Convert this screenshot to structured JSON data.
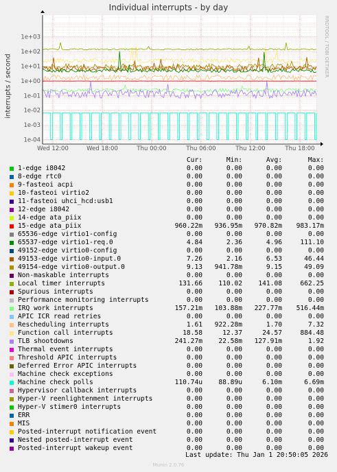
{
  "title": "Individual interrupts - by day",
  "ylabel": "interrupts / second",
  "sidebar_text": "RRDTOOL / TOBI OETIKER",
  "footer_update": "Last update: Thu Jan  1 20:50:05 2026",
  "footer_version": "Munin 2.0.76",
  "columns": {
    "cur": "Cur:",
    "min": "Min:",
    "avg": "Avg:",
    "max": "Max:"
  },
  "chart_data": {
    "type": "line",
    "title": "Individual interrupts - by day",
    "ylabel": "interrupts / second",
    "yscale": "log",
    "ylim": [
      5e-05,
      30000
    ],
    "y_ticks": [
      "1e+03",
      "1e+02",
      "1e+01",
      "1e+00",
      "1e-01",
      "1e-02",
      "1e-03",
      "1e-04"
    ],
    "x_ticks": [
      "Wed 12:00",
      "Wed 18:00",
      "Thu 00:00",
      "Thu 06:00",
      "Thu 12:00",
      "Thu 18:00"
    ],
    "grid": true,
    "series": [
      {
        "name": "1-edge i8042",
        "color": "#00cc00",
        "cur": "0.00",
        "min": "0.00",
        "avg": "0.00",
        "max": "0.00"
      },
      {
        "name": "8-edge rtc0",
        "color": "#0066b3",
        "cur": "0.00",
        "min": "0.00",
        "avg": "0.00",
        "max": "0.00"
      },
      {
        "name": "9-fasteoi acpi",
        "color": "#ff8000",
        "cur": "0.00",
        "min": "0.00",
        "avg": "0.00",
        "max": "0.00"
      },
      {
        "name": "10-fasteoi virtio2",
        "color": "#ffcc00",
        "cur": "0.00",
        "min": "0.00",
        "avg": "0.00",
        "max": "0.00"
      },
      {
        "name": "11-fasteoi uhci_hcd:usb1",
        "color": "#330099",
        "cur": "0.00",
        "min": "0.00",
        "avg": "0.00",
        "max": "0.00"
      },
      {
        "name": "12-edge i8042",
        "color": "#990099",
        "cur": "0.00",
        "min": "0.00",
        "avg": "0.00",
        "max": "0.00"
      },
      {
        "name": "14-edge ata_piix",
        "color": "#ccff00",
        "cur": "0.00",
        "min": "0.00",
        "avg": "0.00",
        "max": "0.00"
      },
      {
        "name": "15-edge ata_piix",
        "color": "#ff0000",
        "cur": "960.22m",
        "min": "936.95m",
        "avg": "970.82m",
        "max": "983.17m"
      },
      {
        "name": "65536-edge virtio1-config",
        "color": "#808080",
        "cur": "0.00",
        "min": "0.00",
        "avg": "0.00",
        "max": "0.00"
      },
      {
        "name": "65537-edge virtio1-req.0",
        "color": "#008f00",
        "cur": "4.84",
        "min": "2.36",
        "avg": "4.96",
        "max": "111.10"
      },
      {
        "name": "49152-edge virtio0-config",
        "color": "#00487d",
        "cur": "0.00",
        "min": "0.00",
        "avg": "0.00",
        "max": "0.00"
      },
      {
        "name": "49153-edge virtio0-input.0",
        "color": "#b35a00",
        "cur": "7.26",
        "min": "2.16",
        "avg": "6.53",
        "max": "46.44"
      },
      {
        "name": "49154-edge virtio0-output.0",
        "color": "#b38f00",
        "cur": "9.13",
        "min": "941.78m",
        "avg": "9.15",
        "max": "49.09"
      },
      {
        "name": "Non-maskable interrupts",
        "color": "#6b006b",
        "cur": "0.00",
        "min": "0.00",
        "avg": "0.00",
        "max": "0.00"
      },
      {
        "name": "Local timer interrupts",
        "color": "#8fb300",
        "cur": "131.66",
        "min": "110.02",
        "avg": "141.08",
        "max": "662.25"
      },
      {
        "name": "Spurious interrupts",
        "color": "#b30000",
        "cur": "0.00",
        "min": "0.00",
        "avg": "0.00",
        "max": "0.00"
      },
      {
        "name": "Performance monitoring interrupts",
        "color": "#bebebe",
        "cur": "0.00",
        "min": "0.00",
        "avg": "0.00",
        "max": "0.00"
      },
      {
        "name": "IRQ work interrupts",
        "color": "#80ff80",
        "cur": "157.21m",
        "min": "103.88m",
        "avg": "227.77m",
        "max": "516.44m"
      },
      {
        "name": "APIC ICR read retries",
        "color": "#80c9ff",
        "cur": "0.00",
        "min": "0.00",
        "avg": "0.00",
        "max": "0.00"
      },
      {
        "name": "Rescheduling interrupts",
        "color": "#ffc080",
        "cur": "1.61",
        "min": "922.28m",
        "avg": "1.70",
        "max": "7.32"
      },
      {
        "name": "Function call interrupts",
        "color": "#ffe680",
        "cur": "18.58",
        "min": "12.37",
        "avg": "24.57",
        "max": "884.48"
      },
      {
        "name": "TLB shootdowns",
        "color": "#aa80ff",
        "cur": "241.27m",
        "min": "22.58m",
        "avg": "127.91m",
        "max": "1.92"
      },
      {
        "name": "Thermal event interrupts",
        "color": "#ee00cc",
        "cur": "0.00",
        "min": "0.00",
        "avg": "0.00",
        "max": "0.00"
      },
      {
        "name": "Threshold APIC interrupts",
        "color": "#ff8080",
        "cur": "0.00",
        "min": "0.00",
        "avg": "0.00",
        "max": "0.00"
      },
      {
        "name": "Deferred Error APIC interrupts",
        "color": "#666600",
        "cur": "0.00",
        "min": "0.00",
        "avg": "0.00",
        "max": "0.00"
      },
      {
        "name": "Machine check exceptions",
        "color": "#ffbfff",
        "cur": "0.00",
        "min": "0.00",
        "avg": "0.00",
        "max": "0.00"
      },
      {
        "name": "Machine check polls",
        "color": "#00ffcc",
        "cur": "110.74u",
        "min": "88.89u",
        "avg": "6.10m",
        "max": "6.69m"
      },
      {
        "name": "Hypervisor callback interrupts",
        "color": "#cc6699",
        "cur": "0.00",
        "min": "0.00",
        "avg": "0.00",
        "max": "0.00"
      },
      {
        "name": "Hyper-V reenlightenment interrupts",
        "color": "#999900",
        "cur": "0.00",
        "min": "0.00",
        "avg": "0.00",
        "max": "0.00"
      },
      {
        "name": "Hyper-V stimer0 interrupts",
        "color": "#00cc00",
        "cur": "0.00",
        "min": "0.00",
        "avg": "0.00",
        "max": "0.00"
      },
      {
        "name": "ERR",
        "color": "#0066b3",
        "cur": "0.00",
        "min": "0.00",
        "avg": "0.00",
        "max": "0.00"
      },
      {
        "name": "MIS",
        "color": "#ff8000",
        "cur": "0.00",
        "min": "0.00",
        "avg": "0.00",
        "max": "0.00"
      },
      {
        "name": "Posted-interrupt notification event",
        "color": "#ffcc00",
        "cur": "0.00",
        "min": "0.00",
        "avg": "0.00",
        "max": "0.00"
      },
      {
        "name": "Nested posted-interrupt event",
        "color": "#330099",
        "cur": "0.00",
        "min": "0.00",
        "avg": "0.00",
        "max": "0.00"
      },
      {
        "name": "Posted-interrupt wakeup event",
        "color": "#990099",
        "cur": "0.00",
        "min": "0.00",
        "avg": "0.00",
        "max": "0.00"
      }
    ]
  }
}
